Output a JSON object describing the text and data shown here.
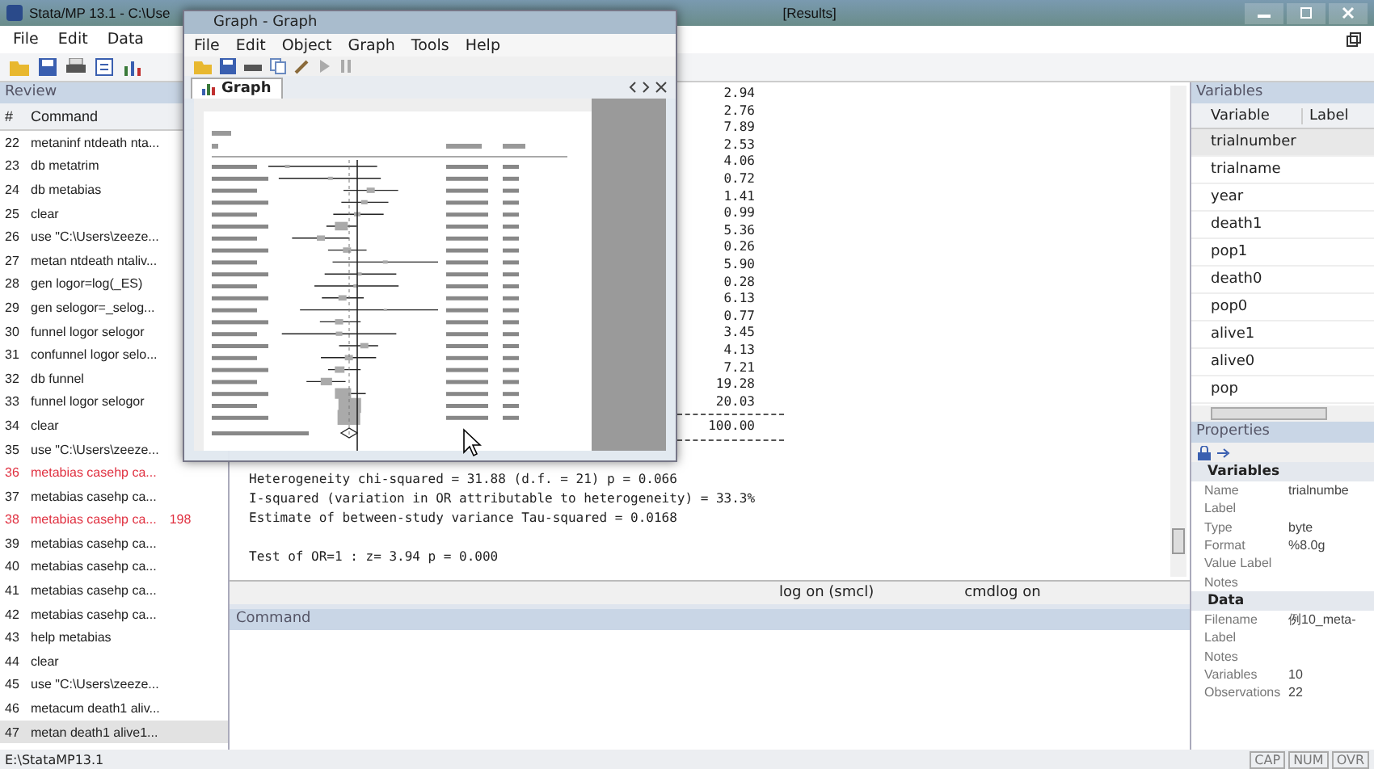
{
  "window": {
    "title": "Stata/MP 13.1 - C:\\Use",
    "title_end": "[Results]"
  },
  "menu": [
    "File",
    "Edit",
    "Data"
  ],
  "review": {
    "title": "Review",
    "columns": [
      "#",
      "Command"
    ],
    "rows": [
      {
        "num": "22",
        "command": "metaninf ntdeath nta...",
        "error": false,
        "selected": false
      },
      {
        "num": "23",
        "command": "db metatrim",
        "error": false,
        "selected": false
      },
      {
        "num": "24",
        "command": "db metabias",
        "error": false,
        "selected": false
      },
      {
        "num": "25",
        "command": "clear",
        "error": false,
        "selected": false
      },
      {
        "num": "26",
        "command": "use \"C:\\Users\\zeeze...",
        "error": false,
        "selected": false
      },
      {
        "num": "27",
        "command": "metan ntdeath ntaliv...",
        "error": false,
        "selected": false
      },
      {
        "num": "28",
        "command": "gen logor=log(_ES)",
        "error": false,
        "selected": false
      },
      {
        "num": "29",
        "command": "gen selogor=_selog...",
        "error": false,
        "selected": false
      },
      {
        "num": "30",
        "command": "funnel logor selogor",
        "error": false,
        "selected": false
      },
      {
        "num": "31",
        "command": "confunnel logor selo...",
        "error": false,
        "selected": false
      },
      {
        "num": "32",
        "command": "db funnel",
        "error": false,
        "selected": false
      },
      {
        "num": "33",
        "command": "funnel logor selogor",
        "error": false,
        "selected": false
      },
      {
        "num": "34",
        "command": "clear",
        "error": false,
        "selected": false
      },
      {
        "num": "35",
        "command": "use \"C:\\Users\\zeeze...",
        "error": false,
        "selected": false
      },
      {
        "num": "36",
        "command": "metabias casehp ca...",
        "error": true,
        "selected": false
      },
      {
        "num": "37",
        "command": "metabias casehp ca...",
        "error": false,
        "selected": false
      },
      {
        "num": "38",
        "command": "metabias casehp ca...",
        "error": true,
        "selected": false,
        "rc": "198"
      },
      {
        "num": "39",
        "command": "metabias casehp ca...",
        "error": false,
        "selected": false
      },
      {
        "num": "40",
        "command": "metabias casehp ca...",
        "error": false,
        "selected": false
      },
      {
        "num": "41",
        "command": "metabias casehp ca...",
        "error": false,
        "selected": false
      },
      {
        "num": "42",
        "command": "metabias casehp ca...",
        "error": false,
        "selected": false
      },
      {
        "num": "43",
        "command": "help metabias",
        "error": false,
        "selected": false
      },
      {
        "num": "44",
        "command": "clear",
        "error": false,
        "selected": false
      },
      {
        "num": "45",
        "command": "use \"C:\\Users\\zeeze...",
        "error": false,
        "selected": false
      },
      {
        "num": "46",
        "command": "metacum death1 aliv...",
        "error": false,
        "selected": false
      },
      {
        "num": "47",
        "command": "metan death1 alive1...",
        "error": false,
        "selected": true
      }
    ]
  },
  "results": {
    "weights": [
      "2.94",
      "2.76",
      "7.89",
      "2.53",
      "4.06",
      "0.72",
      "1.41",
      "0.99",
      "5.36",
      "0.26",
      "5.90",
      "0.28",
      "6.13",
      "0.77",
      "3.45",
      "4.13",
      "7.21",
      "19.28",
      "20.03"
    ],
    "total": "100.00",
    "lines": [
      "Heterogeneity chi-squared =  31.88 (d.f. = 21) p = 0.066",
      "I-squared (variation in OR attributable to heterogeneity) =  33.3%",
      "Estimate of between-study variance Tau-squared =  0.0168",
      "Test of OR=1 : z=   3.94 p = 0.000"
    ],
    "status": [
      "log on (smcl)",
      "cmdlog on"
    ]
  },
  "command_panel": {
    "title": "Command"
  },
  "graph_window": {
    "title": "Graph - Graph",
    "menu": [
      "File",
      "Edit",
      "Object",
      "Graph",
      "Tools",
      "Help"
    ],
    "tab": "Graph"
  },
  "variables": {
    "title": "Variables",
    "columns": [
      "Variable",
      "Label"
    ],
    "rows": [
      {
        "name": "trialnumber",
        "selected": true
      },
      {
        "name": "trialname",
        "selected": false
      },
      {
        "name": "year",
        "selected": false
      },
      {
        "name": "death1",
        "selected": false
      },
      {
        "name": "pop1",
        "selected": false
      },
      {
        "name": "death0",
        "selected": false
      },
      {
        "name": "pop0",
        "selected": false
      },
      {
        "name": "alive1",
        "selected": false
      },
      {
        "name": "alive0",
        "selected": false
      },
      {
        "name": "pop",
        "selected": false
      }
    ]
  },
  "properties": {
    "title": "Properties",
    "sections": [
      {
        "title": "Variables",
        "rows": [
          {
            "key": "Name",
            "value": "trialnumbe"
          },
          {
            "key": "Label"
          },
          {
            "key": "Type",
            "value": "byte"
          },
          {
            "key": "Format",
            "value": "%8.0g"
          },
          {
            "key": "Value Label"
          },
          {
            "key": "Notes"
          }
        ]
      },
      {
        "title": "Data",
        "rows": [
          {
            "key": "Filename",
            "value": "例10_meta-"
          },
          {
            "key": "Label"
          },
          {
            "key": "Notes"
          },
          {
            "key": "Variables",
            "value": "10"
          },
          {
            "key": "Observations",
            "value": "22"
          }
        ]
      }
    ]
  },
  "status_bar": {
    "path": "E:\\StataMP13.1",
    "indicators": [
      "CAP",
      "NUM",
      "OVR"
    ]
  }
}
